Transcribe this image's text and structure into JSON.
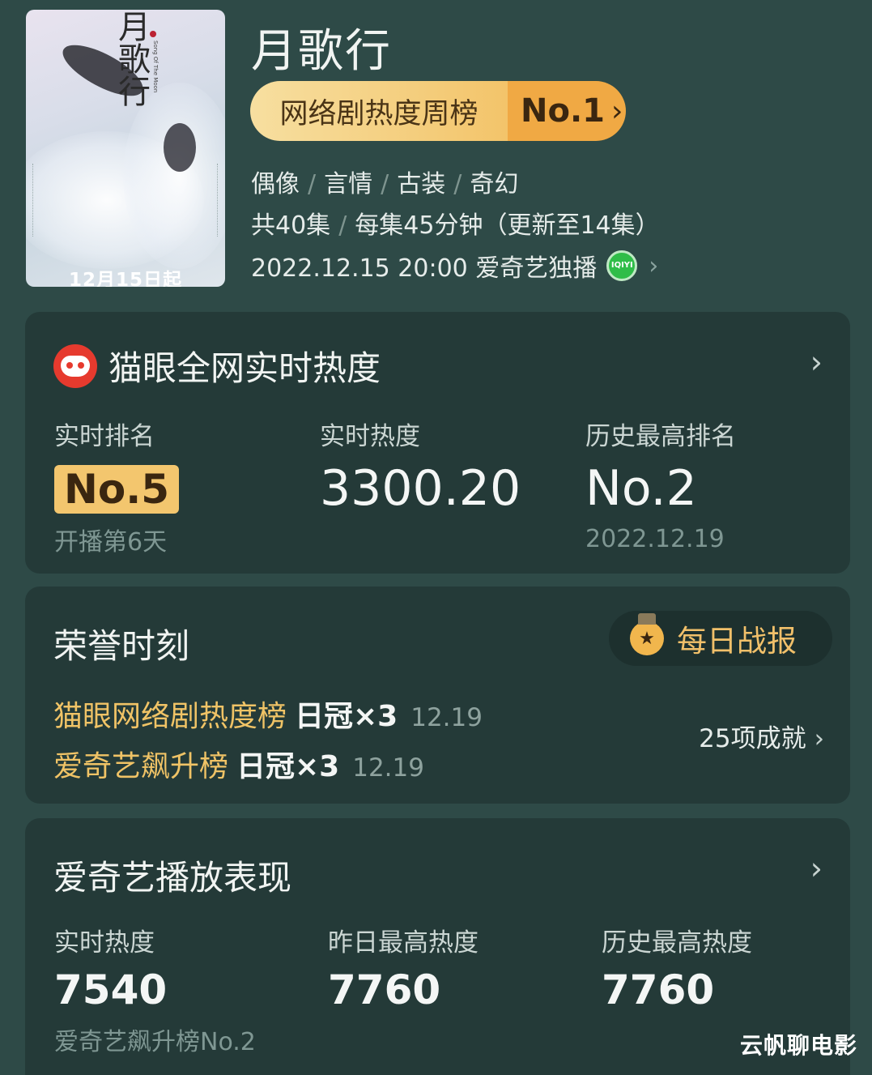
{
  "poster": {
    "vertical_title": "月歌行",
    "english_title": "Song Of The Moon",
    "date_text": "12月15日起"
  },
  "show": {
    "title": "月歌行",
    "rank_label": "网络剧热度周榜",
    "rank_value": "No.1",
    "genres": [
      "偶像",
      "言情",
      "古装",
      "奇幻"
    ],
    "episodes": "共40集",
    "duration": "每集45分钟（更新至14集）",
    "premiere": "2022.12.15 20:00 爱奇艺独播",
    "platform_icon": "IQIYI"
  },
  "maoyan": {
    "title": "猫眼全网实时热度",
    "realtime_rank_label": "实时排名",
    "realtime_rank_value": "No.5",
    "realtime_rank_sub": "开播第6天",
    "realtime_heat_label": "实时热度",
    "realtime_heat_value": "3300.20",
    "best_rank_label": "历史最高排名",
    "best_rank_value": "No.2",
    "best_rank_date": "2022.12.19"
  },
  "honor": {
    "title": "荣誉时刻",
    "daily_report": "每日战报",
    "items": [
      {
        "name": "猫眼网络剧热度榜",
        "crown": "日冠×3",
        "date": "12.19"
      },
      {
        "name": "爱奇艺飙升榜",
        "crown": "日冠×3",
        "date": "12.19"
      }
    ],
    "achievements": "25项成就"
  },
  "iqiyi": {
    "title": "爱奇艺播放表现",
    "realtime_label": "实时热度",
    "realtime_value": "7540",
    "realtime_sub": "爱奇艺飙升榜No.2",
    "yesterday_label": "昨日最高热度",
    "yesterday_value": "7760",
    "history_label": "历史最高热度",
    "history_value": "7760"
  },
  "watermark": "云帆聊电影",
  "colors": {
    "background": "#2e4a47",
    "card": "#243a38",
    "gold": "#f3c66e",
    "accent_text": "#f0c366"
  }
}
